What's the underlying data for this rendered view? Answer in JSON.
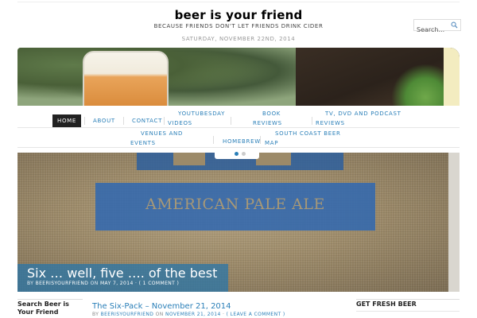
{
  "header": {
    "site_title": "beer is your friend",
    "tagline": "BECAUSE FRIENDS DON'T LET FRIENDS DRINK CIDER",
    "date": "SATURDAY, NOVEMBER 22ND, 2014"
  },
  "search": {
    "placeholder": "Search...",
    "icon": "search-icon"
  },
  "nav": {
    "items": [
      {
        "label": "HOME",
        "active": true
      },
      {
        "label": "ABOUT"
      },
      {
        "label": "CONTACT"
      },
      {
        "label_line1": "YOUTUBESDAY",
        "label_line2": "VIDEOS"
      },
      {
        "label_line1": "BOOK",
        "label_line2": "REVIEWS"
      },
      {
        "label_line1": "TV, DVD AND PODCAST",
        "label_line2": "REVIEWS"
      },
      {
        "label_line1": "VENUES AND",
        "label_line2": "EVENTS"
      },
      {
        "label": "HOMEBREW"
      },
      {
        "label_line1": "SOUTH COAST BEER",
        "label_line2": "MAP"
      }
    ]
  },
  "slider": {
    "title": "Six … well, five …. of the best",
    "meta_by": "BY",
    "author": "BEERISYOURFRIEND",
    "meta_on": "ON",
    "date": "MAY 7, 2014",
    "comments": "( 1 COMMENT )",
    "image_print_text": "AMERICAN PALE ALE",
    "dots": {
      "active_color": "#2a7fb8",
      "inactive_color": "#cccccc"
    }
  },
  "sidebar_left": {
    "title": "Search Beer is Your Friend"
  },
  "post": {
    "title": "The Six-Pack – November 21, 2014",
    "meta_by": "BY",
    "author": "BEERISYOURFRIEND",
    "meta_on": "ON",
    "date": "NOVEMBER 21, 2014",
    "comments": "( LEAVE A COMMENT )"
  },
  "sidebar_right": {
    "widget_title": "GET FRESH BEER"
  },
  "colors": {
    "link": "#2a7fb8",
    "nav_active_bg": "#222222",
    "caption_bg": "#2976a8"
  }
}
